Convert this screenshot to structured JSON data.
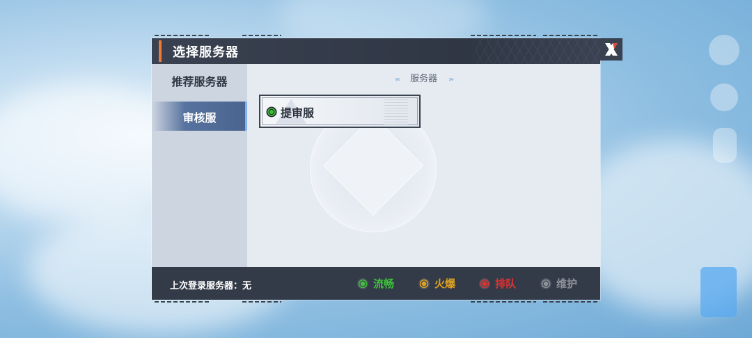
{
  "dialog": {
    "title": "选择服务器",
    "close_icon": "close-x-icon"
  },
  "sidebar": {
    "items": [
      {
        "label": "推荐服务器",
        "selected": false
      },
      {
        "label": "审核服",
        "selected": true
      }
    ]
  },
  "content": {
    "header_label": "服务器",
    "left_arrows": "«‹",
    "right_arrows": "›»",
    "servers": [
      {
        "name": "提审服",
        "status": "流畅",
        "status_color": "#3fc23a"
      }
    ]
  },
  "footer": {
    "last_login_label": "上次登录服务器：",
    "last_login_value": "无",
    "legend": [
      {
        "label": "流畅",
        "color": "#3fc23a"
      },
      {
        "label": "火爆",
        "color": "#e0a21e"
      },
      {
        "label": "排队",
        "color": "#e03131"
      },
      {
        "label": "维护",
        "color": "#8d929a"
      }
    ]
  }
}
